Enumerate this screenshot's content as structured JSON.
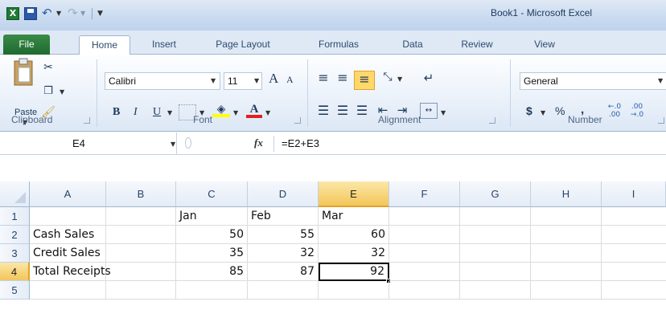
{
  "window": {
    "title": "Book1  -  Microsoft Excel",
    "logo_letter": "X"
  },
  "tabs": [
    "File",
    "Home",
    "Insert",
    "Page Layout",
    "Formulas",
    "Data",
    "Review",
    "View"
  ],
  "active_tab": "Home",
  "ribbon": {
    "clipboard": {
      "label": "Clipboard",
      "paste": "Paste"
    },
    "font": {
      "label": "Font",
      "name": "Calibri",
      "size": "11",
      "bold": "B",
      "italic": "I",
      "underline": "U",
      "grow": "A",
      "shrink": "A",
      "font_color": "A"
    },
    "alignment": {
      "label": "Alignment"
    },
    "number": {
      "label": "Number",
      "format": "General",
      "currency": "$",
      "percent": "%",
      "comma": ","
    }
  },
  "formula_bar": {
    "name_box": "E4",
    "fx": "fx",
    "formula": "=E2+E3"
  },
  "columns": [
    "A",
    "B",
    "C",
    "D",
    "E",
    "F",
    "G",
    "H",
    "I"
  ],
  "rows": [
    "1",
    "2",
    "3",
    "4",
    "5"
  ],
  "selected": {
    "column": "E",
    "row": "4"
  },
  "cells": {
    "r1": {
      "C": "Jan",
      "D": "Feb",
      "E": "Mar"
    },
    "r2": {
      "A": "Cash Sales",
      "C": "50",
      "D": "55",
      "E": "60"
    },
    "r3": {
      "A": "Credit Sales",
      "C": "35",
      "D": "32",
      "E": "32"
    },
    "r4": {
      "A": "Total Receipts",
      "C": "85",
      "D": "87",
      "E": "92"
    }
  },
  "colors": {
    "accent_file": "#1d6b2e",
    "selection": "#f3c659",
    "highlight_button": "#ffd86b"
  }
}
